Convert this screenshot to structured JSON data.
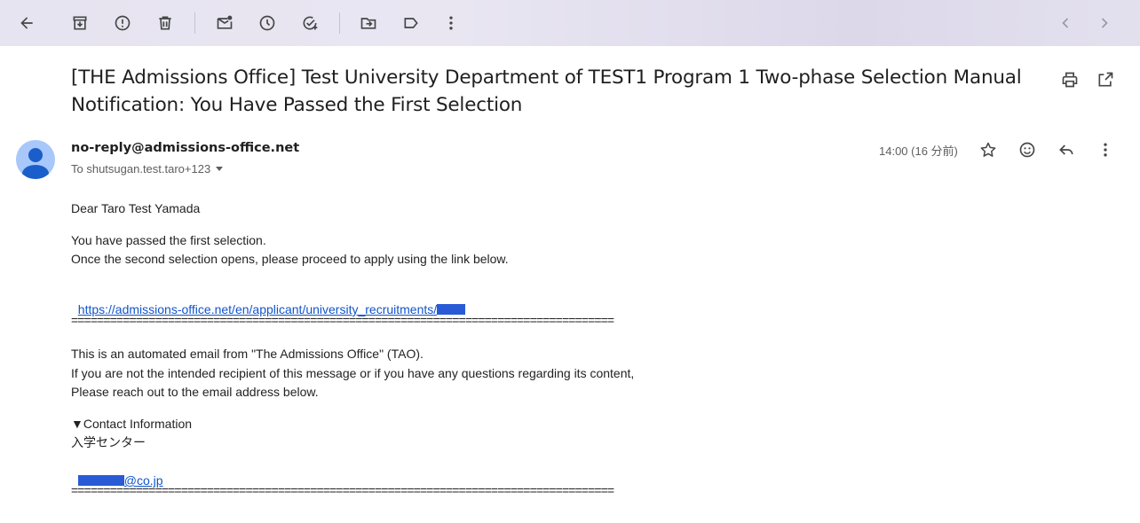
{
  "toolbar": {
    "icons": [
      "back-arrow-icon",
      "archive-icon",
      "report-spam-icon",
      "delete-icon",
      "mark-unread-icon",
      "snooze-icon",
      "add-to-tasks-icon",
      "move-to-icon",
      "labels-icon",
      "more-vert-icon",
      "prev-icon",
      "next-icon"
    ]
  },
  "email": {
    "subject_line1": "[THE Admissions Office] Test University Department of TEST1 Program 1 Two-phase Selection Manual",
    "subject_line2": "Notification: You Have Passed the First Selection",
    "sender": "no-reply@admissions-office.net",
    "to": "To shutsugan.test.taro+123",
    "time": "14:00 (16 分前)",
    "greeting": "Dear Taro Test Yamada",
    "para1_line1": "You have passed the first selection.",
    "para1_line2": "Once the second selection opens, please proceed to apply using the link below.",
    "link": "https://admissions-office.net/en/applicant/university_recruitments/",
    "divider": "====================================================================================",
    "para2_line1": "This is an automated email from \"The Admissions Office\" (TAO).",
    "para2_line2": "If you are not the intended recipient of this message or if you have any questions regarding its content,",
    "para2_line3": "Please reach out to the email address below.",
    "contact_heading": "▼Contact Information",
    "contact_dept": "入学センター",
    "contact_email_suffix": "@co.jp"
  },
  "colors": {
    "link": "#1155cc",
    "redaction": "#2a5bd7",
    "avatar_bg": "#a8c7fa",
    "avatar_fg": "#1a5ec9"
  }
}
